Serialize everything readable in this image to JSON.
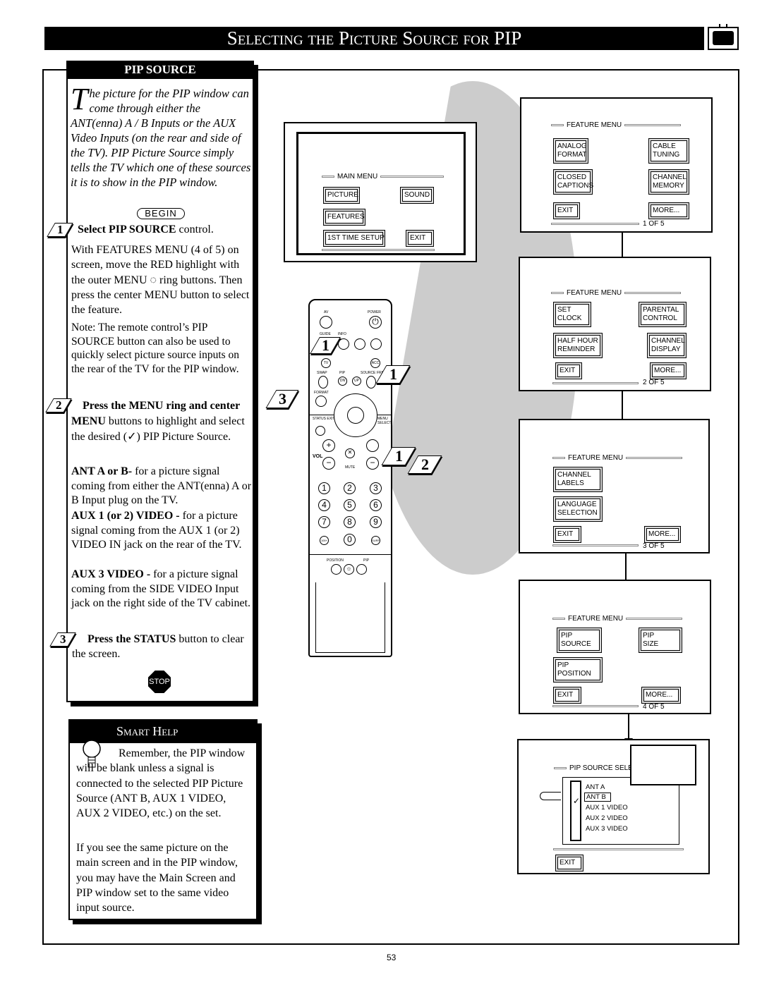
{
  "title": "Selecting the Picture Source for PIP",
  "pip_source": {
    "header": "PIP SOURCE",
    "intro_dropcap": "T",
    "intro": "he picture for the PIP window can come through either the ANT(enna) A / B Inputs or the AUX Video Inputs (on the rear and side of the TV). PIP Picture Source simply tells the TV which one of these sources it is to show in the PIP window.",
    "begin_label": "BEGIN",
    "step1_num": "1",
    "step1_bold": "Select PIP SOURCE",
    "step1_rest": " control.",
    "step1_body": "With FEATURES MENU (4 of 5) on screen, move the RED highlight with the outer MENU ◌ ring buttons. Then press the center MENU button to select the feature.",
    "note": "Note: The remote control’s PIP SOURCE button can also be used to quickly select picture source inputs on the rear of the TV for the PIP window.",
    "step2_num": "2",
    "step2_bold": "Press the MENU ring and center MENU",
    "step2_rest": " buttons to highlight and select the desired (✓) PIP Picture Source.",
    "ant_bold": "ANT A or B-",
    "ant_rest": " for a picture signal coming from either the ANT(enna) A or B Input plug on the TV.",
    "aux12_bold": "AUX 1 (or 2) VIDEO -",
    "aux12_rest": " for a picture signal coming from the AUX 1 (or 2) VIDEO IN jack on the rear of the TV.",
    "aux3_bold": "AUX 3 VIDEO -",
    "aux3_rest": " for a picture signal coming from the SIDE VIDEO Input jack on the right side of the TV cabinet.",
    "step3_num": "3",
    "step3_bold": "Press the STATUS",
    "step3_rest": " button to clear the screen.",
    "stop_label": "STOP"
  },
  "smart_help": {
    "header": "Smart Help",
    "p1": "Remember, the PIP window will be blank unless a signal is connected to the selected PIP Picture Source (ANT B, AUX 1 VIDEO, AUX 2 VIDEO, etc.) on the set.",
    "p2": "If you see the same picture on the main screen and in the PIP window, you may have the Main Screen and PIP window set to the same video input source."
  },
  "main_menu": {
    "title": "MAIN MENU",
    "items": [
      "PICTURE",
      "SOUND",
      "FEATURES",
      "1ST TIME SETUP",
      "EXIT"
    ]
  },
  "remote": {
    "labels": [
      "AV",
      "POWER",
      "GUIDE",
      "INFO",
      "TV",
      "ACC",
      "SWAP",
      "PIP",
      "SOURCE",
      "FREEZE",
      "DN",
      "UP",
      "FORMAT",
      "STATUS EXIT",
      "MENU SELECT",
      "VOL",
      "MUTE",
      "POSITION",
      "PIP",
      "100+",
      "SURF"
    ],
    "digits": [
      "1",
      "2",
      "3",
      "4",
      "5",
      "6",
      "7",
      "8",
      "9",
      "0"
    ],
    "callouts": [
      "1",
      "1",
      "3",
      "1",
      "2"
    ]
  },
  "feature_menus": [
    {
      "title": "FEATURE MENU",
      "items": [
        "ANALOG\nFORMAT",
        "CABLE\nTUNING",
        "CLOSED\nCAPTIONS",
        "CHANNEL\nMEMORY",
        "EXIT",
        "MORE..."
      ],
      "page": "1  OF 5"
    },
    {
      "title": "FEATURE MENU",
      "items": [
        "SET\nCLOCK",
        "PARENTAL\nCONTROL",
        "HALF HOUR\nREMINDER",
        "CHANNEL\nDISPLAY",
        "EXIT",
        "MORE..."
      ],
      "page": "2  OF 5"
    },
    {
      "title": "FEATURE MENU",
      "items": [
        "CHANNEL\nLABELS",
        "LANGUAGE\nSELECTION",
        "EXIT",
        "MORE..."
      ],
      "page": "3  OF 5"
    },
    {
      "title": "FEATURE MENU",
      "items": [
        "PIP\nSOURCE",
        "PIP\nSIZE",
        "PIP\nPOSITION",
        "EXIT",
        "MORE..."
      ],
      "page": "4  OF 5"
    }
  ],
  "pip_select": {
    "title": "PIP SOURCE SELECT",
    "options": [
      "ANT A",
      "ANT B",
      "AUX 1  VIDEO",
      "AUX 2  VIDEO",
      "AUX 3  VIDEO"
    ],
    "selected": "ANT B",
    "check": "✓",
    "exit": "EXIT"
  },
  "page_number": "53"
}
